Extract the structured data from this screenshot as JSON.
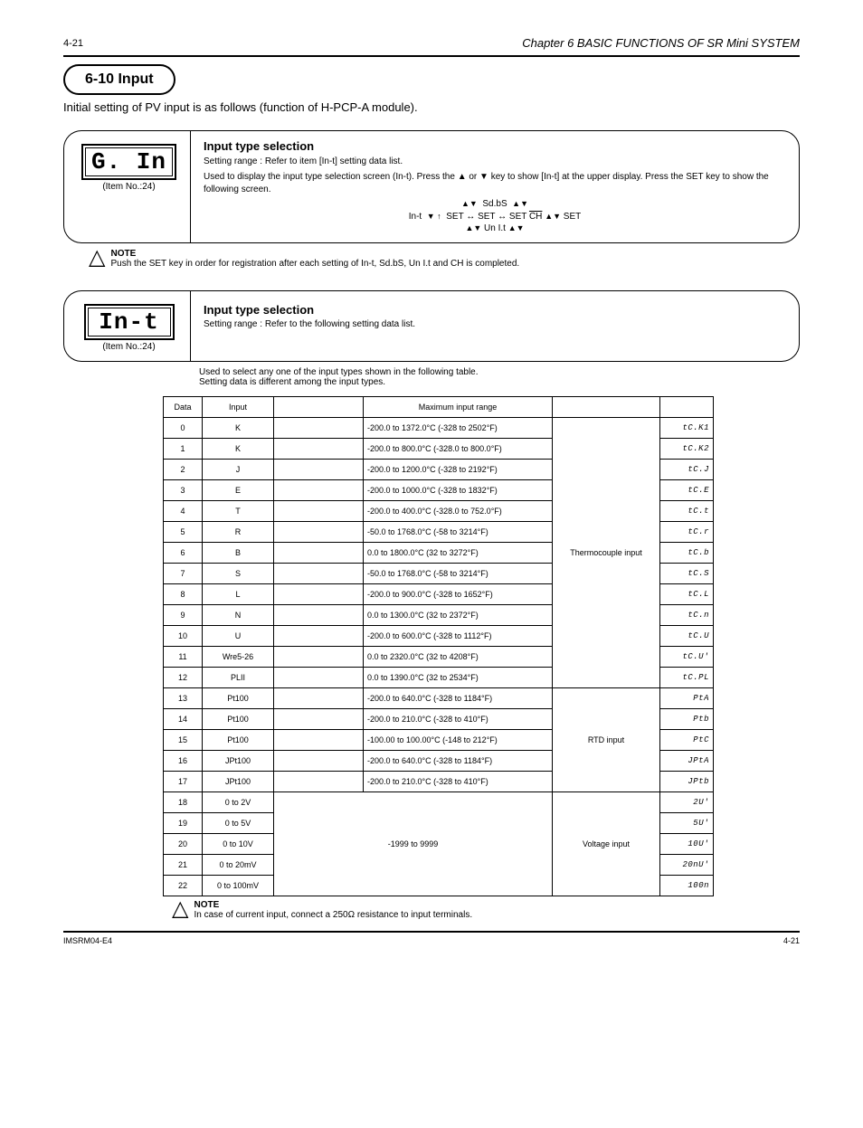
{
  "header": {
    "heading": "Chapter 6  BASIC FUNCTIONS OF SR Mini SYSTEM",
    "page_header": "4-21",
    "page_footer": "IMSRM04-E4"
  },
  "section": {
    "pill": "6-10 Input",
    "sub": "Initial setting of PV input is as follows (function of H-PCP-A module)."
  },
  "param1": {
    "lcd": "G. In",
    "lcd_sub": "(Item No.:24)",
    "title": "Input type selection",
    "range": "Setting range : Refer to item [In-t] setting data list.",
    "intro": "Used to display the input type selection screen (In-t). Press the ▲ or ▼ key to show [In-t] at the upper display. Press the SET key to show the following screen.",
    "layout_a": "▲▼  Sd.bS  ▲▼",
    "layout_b": "In-t ▼ ↑ SET ↔ SET ↔ SET CH ▲▼ SET",
    "layout_c": "▲▼ Un I.t ▲▼"
  },
  "note1": "Push the SET key in order for registration after each setting of In-t, Sd.bS, Un I.t and CH is completed.",
  "param2": {
    "lcd": "In-t",
    "lcd_sub": "(Item No.:24)",
    "title": "Input type selection",
    "range": "Setting range : Refer to the following setting data list.",
    "body1": "Used to select any one of the input types shown in the following table.",
    "body2": "Setting data is different among the input types."
  },
  "table": {
    "headers": [
      "Data",
      "Input",
      "",
      "Maximum input range",
      "",
      ""
    ],
    "rows": [
      {
        "d": "0",
        "in": "K",
        "c3": "",
        "range": "-200.0 to 1372.0°C (-328 to 2502°F)",
        "group": "Thermocouple input",
        "seg": "tC.K1"
      },
      {
        "d": "1",
        "in": "K",
        "c3": "",
        "range": "-200.0 to 800.0°C (-328.0 to 800.0°F)",
        "group": "",
        "seg": "tC.K2"
      },
      {
        "d": "2",
        "in": "J",
        "c3": "",
        "range": "-200.0 to 1200.0°C (-328 to 2192°F)",
        "group": "",
        "seg": "tC.J"
      },
      {
        "d": "3",
        "in": "E",
        "c3": "",
        "range": "-200.0 to 1000.0°C (-328 to 1832°F)",
        "group": "",
        "seg": "tC.E"
      },
      {
        "d": "4",
        "in": "T",
        "c3": "",
        "range": "-200.0 to 400.0°C (-328.0 to 752.0°F)",
        "group": "",
        "seg": "tC.t"
      },
      {
        "d": "5",
        "in": "R",
        "c3": "",
        "range": "-50.0 to 1768.0°C (-58 to 3214°F)",
        "group": "",
        "seg": "tC.r"
      },
      {
        "d": "6",
        "in": "B",
        "c3": "",
        "range": "0.0 to 1800.0°C (32 to 3272°F)",
        "group": "",
        "seg": "tC.b"
      },
      {
        "d": "7",
        "in": "S",
        "c3": "",
        "range": "-50.0 to 1768.0°C (-58 to 3214°F)",
        "group": "",
        "seg": "tC.S"
      },
      {
        "d": "8",
        "in": "L",
        "c3": "",
        "range": "-200.0 to 900.0°C (-328 to 1652°F)",
        "group": "",
        "seg": "tC.L"
      },
      {
        "d": "9",
        "in": "N",
        "c3": "",
        "range": "0.0 to 1300.0°C (32 to 2372°F)",
        "group": "",
        "seg": "tC.n"
      },
      {
        "d": "10",
        "in": "U",
        "c3": "",
        "range": "-200.0 to 600.0°C (-328 to 1112°F)",
        "group": "",
        "seg": "tC.U"
      },
      {
        "d": "11",
        "in": "Wre5-26",
        "c3": "",
        "range": "0.0 to 2320.0°C (32 to 4208°F)",
        "group": "",
        "seg": "tC.U'"
      },
      {
        "d": "12",
        "in": "PLII",
        "c3": "",
        "range": "0.0 to 1390.0°C (32 to 2534°F)",
        "group": "",
        "seg": "tC.PL"
      },
      {
        "d": "13",
        "in": "Pt100",
        "c3": "",
        "range": "-200.0 to 640.0°C (-328 to 1184°F)",
        "group": "RTD input",
        "seg": "PtA"
      },
      {
        "d": "14",
        "in": "Pt100",
        "c3": "",
        "range": "-200.0 to 210.0°C (-328 to 410°F)",
        "group": "",
        "seg": "Ptb"
      },
      {
        "d": "15",
        "in": "Pt100",
        "c3": "",
        "range": "-100.00 to 100.00°C (-148 to 212°F)",
        "group": "",
        "seg": "PtC"
      },
      {
        "d": "16",
        "in": "JPt100",
        "c3": "",
        "range": "-200.0 to 640.0°C (-328 to 1184°F)",
        "group": "",
        "seg": "JPtA"
      },
      {
        "d": "17",
        "in": "JPt100",
        "c3": "",
        "range": "-200.0 to 210.0°C (-328 to 410°F)",
        "group": "",
        "seg": "JPtb"
      },
      {
        "d": "18",
        "in": "0 to 2V",
        "c3": "-1999 to 9999",
        "range": "",
        "group": "Voltage input",
        "seg": "2U'"
      },
      {
        "d": "19",
        "in": "0 to 5V",
        "c3": "",
        "range": "",
        "group": "",
        "seg": "5U'"
      },
      {
        "d": "20",
        "in": "0 to 10V",
        "c3": "",
        "range": "",
        "group": "",
        "seg": "10U'"
      },
      {
        "d": "21",
        "in": "0 to 20mV",
        "c3": "",
        "range": "",
        "group": "",
        "seg": "20nU'"
      },
      {
        "d": "22",
        "in": "0 to 100mV",
        "c3": "",
        "range": "",
        "group": "",
        "seg": "100n"
      }
    ]
  },
  "note2": "In case of current input, connect a 250Ω resistance to input terminals.",
  "footer_right": "4-21"
}
